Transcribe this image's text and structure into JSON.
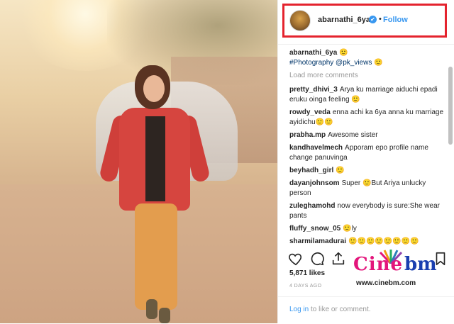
{
  "post": {
    "username": "abarnathi_6ya",
    "verified_glyph": "✔",
    "separator": "•",
    "follow_label": "Follow",
    "caption": {
      "username": "abarnathi_6ya",
      "text": "🙂",
      "hashtag": "#Photography @pk_views 🙂"
    },
    "load_more": "Load more comments",
    "comments": [
      {
        "user": "pretty_dhivi_3",
        "text": "Arya ku marriage aiduchi epadi eruku oinga feeling 🙂"
      },
      {
        "user": "rowdy_veda",
        "text": "enna achi ka 6ya anna ku marriage ayidichu🙂🙂"
      },
      {
        "user": "prabha.mp",
        "text": "Awesome sister"
      },
      {
        "user": "kandhavelmech",
        "text": "Apporam epo profile name change panuvinga"
      },
      {
        "user": "beyhadh_girl",
        "text": "🙂"
      },
      {
        "user": "dayanjohnsom",
        "text": "Super 🙂But Ariya unlucky person"
      },
      {
        "user": "zuleghamohd",
        "text": "now everybody is sure:She wear pants"
      },
      {
        "user": "fluffy_snow_05",
        "text": "🙂ly"
      },
      {
        "user": "sharmilamadurai",
        "text": "🙂🙂🙂🙂🙂🙂🙂🙂"
      }
    ],
    "likes": "5,871 likes",
    "time": "4 DAYS AGO",
    "footer": {
      "login": "Log in",
      "rest": " to like or comment."
    }
  },
  "watermark": {
    "cine": "Cine",
    "bm": "bm",
    "url": "www.cinebm.com"
  },
  "colors": {
    "highlight": "#e4232e",
    "link": "#3897f0"
  }
}
